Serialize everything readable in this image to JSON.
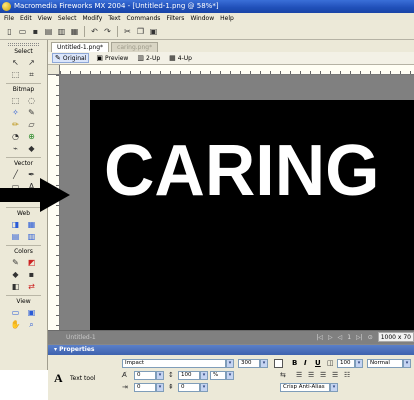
{
  "window": {
    "title": "Macromedia Fireworks MX 2004 - [Untitled-1.png @ 58%*]"
  },
  "menu": [
    "File",
    "Edit",
    "View",
    "Select",
    "Modify",
    "Text",
    "Commands",
    "Filters",
    "Window",
    "Help"
  ],
  "tools": {
    "sections": {
      "select": "Select",
      "bitmap": "Bitmap",
      "vector": "Vector",
      "web": "Web",
      "colors": "Colors",
      "view": "View"
    }
  },
  "document": {
    "tabs": [
      "Untitled-1.png*",
      "caring.png*"
    ],
    "view_buttons": [
      "Original",
      "Preview",
      "2-Up",
      "4-Up"
    ],
    "canvas_text": "CARING",
    "status_left": "Untitled-1",
    "page_number": "1",
    "dimensions": "1000 x 70"
  },
  "properties": {
    "title": "Properties",
    "tool_icon_letter": "A",
    "tool_name": "Text tool",
    "font": "Impact",
    "size": "300",
    "kerning": "0",
    "leading": "100",
    "leading_unit": "%",
    "text_scale": "100",
    "blend_mode": "Normal",
    "indent": "0",
    "space_before": "0",
    "anti_alias": "Crisp Anti-Alias",
    "format_bold": "B",
    "format_italic": "I",
    "format_underline": "U"
  },
  "colors": {
    "title_bar": "#245EDC",
    "panel_bg": "#ECE9D8",
    "canvas_bg": "#000000",
    "canvas_text": "#FFFFFF",
    "doc_gray": "#808080"
  }
}
